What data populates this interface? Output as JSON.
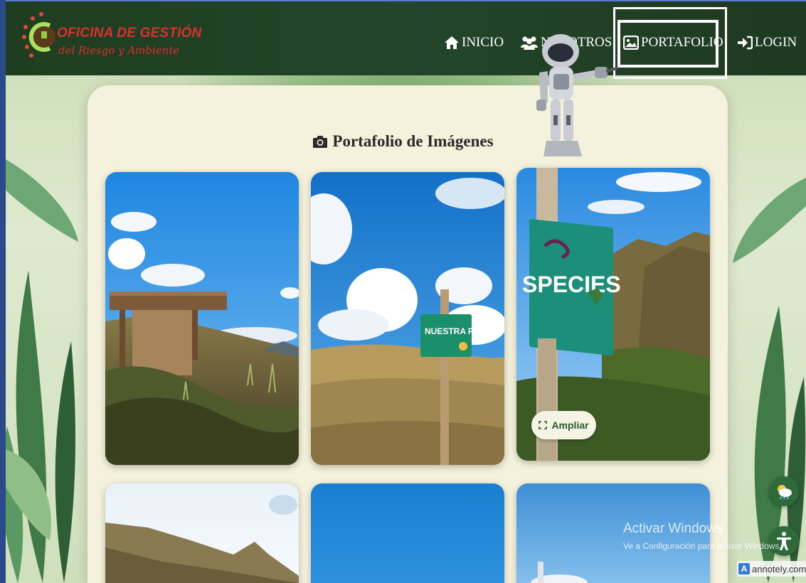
{
  "brand": {
    "line1": "OFICINA DE GESTIÓN",
    "line2": "del Riesgo y Ambiente"
  },
  "nav": {
    "inicio": "INICIO",
    "nosotros": "NOSOTROS",
    "portafolio": "PORTAFOLIO",
    "login": "LOGIN"
  },
  "main": {
    "title": "Portafolio de Imágenes",
    "ampliar_label": "Ampliar",
    "photos": [
      {
        "sign": ""
      },
      {
        "sign": "NUESTRA FLORA"
      },
      {
        "sign": "SPECIES"
      }
    ]
  },
  "watermark": {
    "title": "Activar Windows",
    "subtitle": "Ve a Configuración para activar Windows."
  },
  "annotely": {
    "letter": "A",
    "label": "annotely.com"
  },
  "icons": {
    "inicio": "home-icon",
    "nosotros": "users-icon",
    "portafolio": "image-icon",
    "login": "sign-in-icon",
    "title": "camera-icon",
    "ampliar": "expand-icon",
    "weather": "weather-icon",
    "accessibility": "accessibility-icon"
  },
  "colors": {
    "navbar": "#1f3d1f",
    "brand_red": "#d93030",
    "card": "#f4f2dc",
    "fab": "#2f6b3a"
  }
}
